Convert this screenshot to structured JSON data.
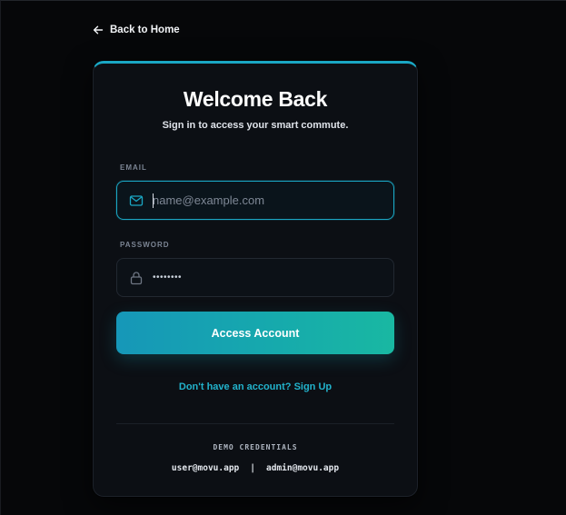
{
  "nav": {
    "back_label": "Back to Home",
    "back_icon": "arrow-left-icon"
  },
  "login": {
    "title": "Welcome Back",
    "subtitle": "Sign in to access your smart commute.",
    "email": {
      "label": "EMAIL",
      "placeholder": "name@example.com",
      "value": "",
      "icon": "mail-icon"
    },
    "password": {
      "label": "PASSWORD",
      "masked_value": "••••••••",
      "icon": "lock-icon"
    },
    "submit_label": "Access Account",
    "signup_text": "Don't have an account? Sign Up"
  },
  "demo": {
    "title": "DEMO CREDENTIALS",
    "user_email": "user@movu.app",
    "separator": "|",
    "admin_email": "admin@movu.app"
  },
  "colors": {
    "background": "#060709",
    "card": "#0c0f14",
    "accent": "#1aa7c4",
    "accent_end": "#19b8a2",
    "link": "#22b3cc"
  }
}
